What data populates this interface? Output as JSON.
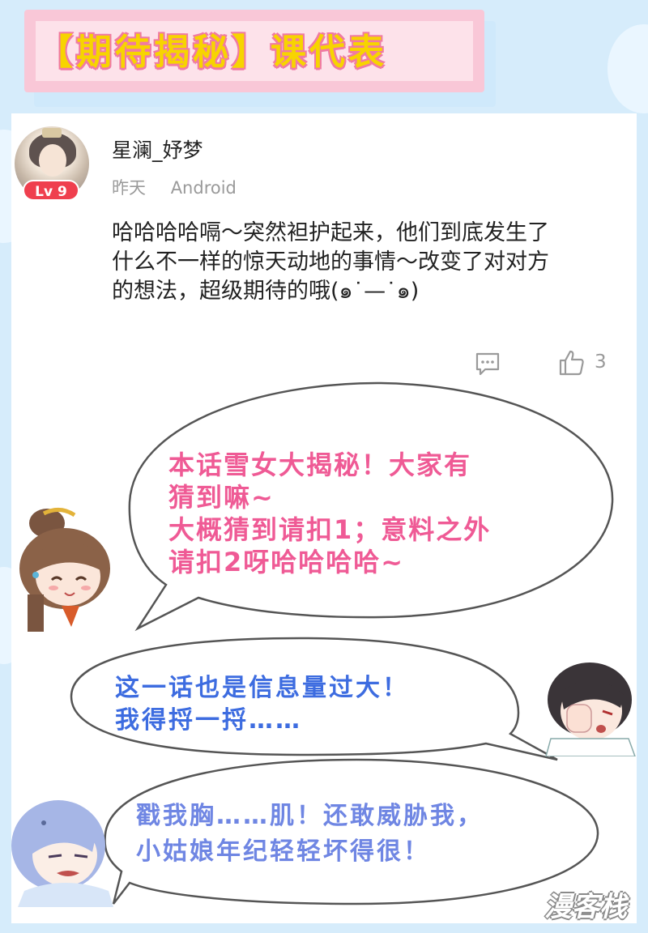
{
  "banner": {
    "title": "【期待揭秘】课代表"
  },
  "comment": {
    "username": "星澜_妤梦",
    "level": "Lv 9",
    "time": "昨天",
    "device": "Android",
    "lines": [
      "哈哈哈哈嗝～突然袒护起来，他们到底发生了",
      "什么不一样的惊天动地的事情～改变了对对方",
      "的想法，超级期待的哦(๑˙—˙๑)"
    ],
    "like_count": "3"
  },
  "bubbles": {
    "pink": [
      "本话雪女大揭秘！大家有",
      "猜到嘛~",
      "大概猜到请扣1；意料之外",
      "请扣2呀哈哈哈哈~"
    ],
    "blue": [
      "这一话也是信息量过大！",
      "我得捋一捋……"
    ],
    "purple": [
      "戳我胸……肌！还敢威胁我，",
      "小姑娘年纪轻轻坏得很！"
    ]
  },
  "watermark": "漫客栈",
  "colors": {
    "pink_text": "#ef5a95",
    "blue_text": "#3d6ce0",
    "purple_text": "#6f86e3",
    "banner_yellow": "#f7d400",
    "level_red": "#ef3f4e"
  },
  "icons": {
    "reply": "comment-bubble-icon",
    "like": "thumbs-up-icon"
  }
}
